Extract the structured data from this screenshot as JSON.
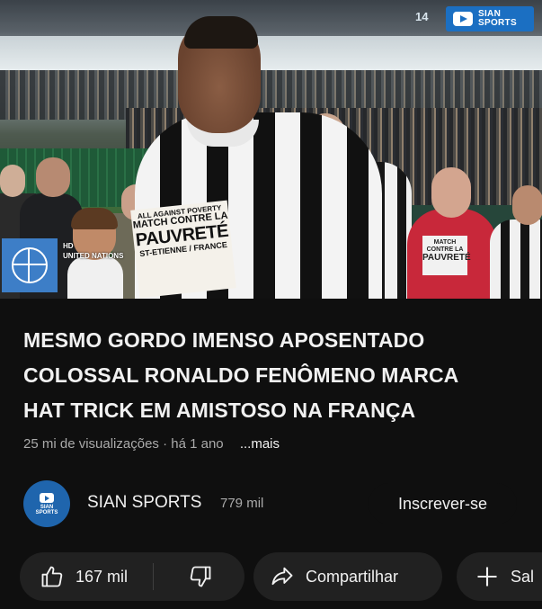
{
  "video": {
    "overlay_number": "14",
    "channel_badge": [
      "SIAN",
      "SPORTS"
    ],
    "un_logo_text": "UNITED NATIONS",
    "un_logo_hd": "HD",
    "bib_main": [
      "ALL AGAINST POVERTY",
      "MATCH CONTRE LA",
      "PAUVRETÉ",
      "ST-ETIENNE / FRANCE"
    ],
    "bib_red": [
      "MATCH CONTRE LA",
      "PAUVRETÉ"
    ]
  },
  "title_lines": [
    "MESMO GORDO IMENSO APOSENTADO",
    "COLOSSAL RONALDO FENÔMENO MARCA",
    "HAT TRICK EM AMISTOSO NA FRANÇA"
  ],
  "meta": {
    "views": "25 mi de visualizações",
    "separator": "·",
    "age": "há 1 ano",
    "more": "...mais"
  },
  "channel": {
    "name": "SIAN SPORTS",
    "subscribers": "779 mil",
    "subscribe_label": "Inscrever-se",
    "avatar_text": [
      "SIAN",
      "SPORTS"
    ]
  },
  "actions": {
    "like_count": "167 mil",
    "share_label": "Compartilhar",
    "save_label": "Sal"
  },
  "colors": {
    "background": "#0f0f0f",
    "pill": "#212121",
    "secondary_text": "#aaaaaa",
    "badge_blue": "#1b6fc2"
  },
  "icons": [
    "thumbs-up-icon",
    "thumbs-down-icon",
    "share-icon",
    "plus-icon",
    "play-icon",
    "un-globe-icon"
  ]
}
